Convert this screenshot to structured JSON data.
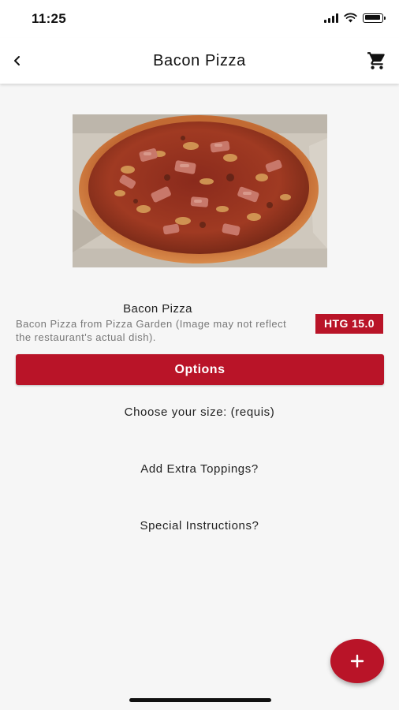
{
  "status_bar": {
    "time": "11:25"
  },
  "app_bar": {
    "title": "Bacon Pizza",
    "back_icon": "chevron-left-icon",
    "cart_icon": "shopping-cart-icon"
  },
  "product": {
    "image_icon": "bacon-pizza-photo",
    "name": "Bacon Pizza",
    "description": "Bacon Pizza from Pizza Garden (Image may not reflect the restaurant's actual dish).",
    "price": "HTG 15.0"
  },
  "options": {
    "button_label": "Options",
    "size_label": "Choose your size:  (requis)",
    "toppings_label": "Add Extra Toppings?",
    "instructions_label": "Special Instructions?"
  },
  "fab": {
    "icon": "plus-icon"
  },
  "colors": {
    "accent": "#b91428",
    "background": "#f6f6f6",
    "muted_text": "#777777"
  }
}
